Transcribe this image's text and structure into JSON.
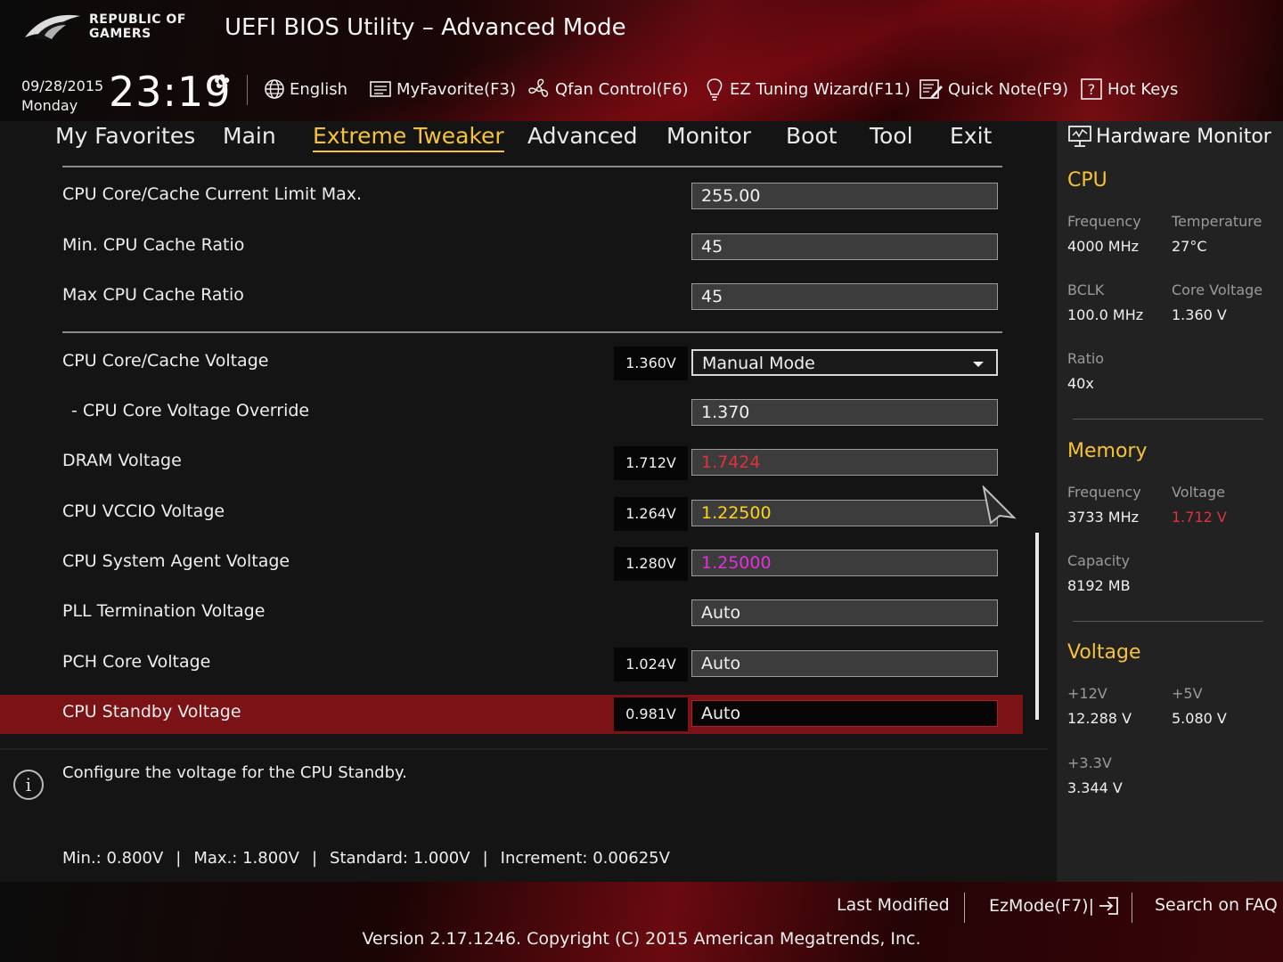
{
  "header": {
    "brand_line1": "REPUBLIC OF",
    "brand_line2": "GAMERS",
    "title": "UEFI BIOS Utility – Advanced Mode",
    "date": "09/28/2015",
    "day": "Monday",
    "time": "23:19",
    "tools": [
      {
        "label": "English",
        "icon": "globe-icon"
      },
      {
        "label": "MyFavorite(F3)",
        "icon": "favorite-icon"
      },
      {
        "label": "Qfan Control(F6)",
        "icon": "fan-icon"
      },
      {
        "label": "EZ Tuning Wizard(F11)",
        "icon": "bulb-icon"
      },
      {
        "label": "Quick Note(F9)",
        "icon": "note-icon"
      },
      {
        "label": "Hot Keys",
        "icon": "help-icon"
      }
    ]
  },
  "tabs": [
    {
      "label": "My Favorites"
    },
    {
      "label": "Main"
    },
    {
      "label": "Extreme Tweaker",
      "active": true
    },
    {
      "label": "Advanced"
    },
    {
      "label": "Monitor"
    },
    {
      "label": "Boot"
    },
    {
      "label": "Tool"
    },
    {
      "label": "Exit"
    }
  ],
  "settings": [
    {
      "label": "CPU Core/Cache Current Limit Max.",
      "value": "255.00"
    },
    {
      "label": "Min. CPU Cache Ratio",
      "value": "45"
    },
    {
      "label": "Max CPU Cache Ratio",
      "value": "45"
    },
    {
      "label": "CPU Core/Cache Voltage",
      "current": "1.360V",
      "value": "Manual Mode"
    },
    {
      "label": "- CPU Core Voltage Override",
      "value": "1.370"
    },
    {
      "label": "DRAM Voltage",
      "current": "1.712V",
      "value": "1.7424",
      "value_color": "#e0323a"
    },
    {
      "label": "CPU VCCIO Voltage",
      "current": "1.264V",
      "value": "1.22500",
      "value_color": "#ffd21a"
    },
    {
      "label": "CPU System Agent Voltage",
      "current": "1.280V",
      "value": "1.25000",
      "value_color": "#e52ee0"
    },
    {
      "label": "PLL Termination Voltage",
      "value": "Auto"
    },
    {
      "label": "PCH Core Voltage",
      "current": "1.024V",
      "value": "Auto"
    },
    {
      "label": "CPU Standby Voltage",
      "current": "0.981V",
      "value": "Auto",
      "selected": true
    }
  ],
  "help": {
    "description": "Configure the voltage for the CPU Standby.",
    "min": "Min.: 0.800V",
    "max": "Max.: 1.800V",
    "standard": "Standard: 1.000V",
    "increment": "Increment: 0.00625V",
    "separator": "|"
  },
  "hw_monitor": {
    "title": "Hardware Monitor",
    "cpu": {
      "title": "CPU",
      "frequency_label": "Frequency",
      "frequency": "4000 MHz",
      "temperature_label": "Temperature",
      "temperature": "27°C",
      "bclk_label": "BCLK",
      "bclk": "100.0 MHz",
      "core_voltage_label": "Core Voltage",
      "core_voltage": "1.360 V",
      "ratio_label": "Ratio",
      "ratio": "40x"
    },
    "memory": {
      "title": "Memory",
      "frequency_label": "Frequency",
      "frequency": "3733 MHz",
      "voltage_label": "Voltage",
      "voltage": "1.712 V",
      "capacity_label": "Capacity",
      "capacity": "8192 MB"
    },
    "voltage": {
      "title": "Voltage",
      "v12_label": "+12V",
      "v12": "12.288 V",
      "v5_label": "+5V",
      "v5": "5.080 V",
      "v33_label": "+3.3V",
      "v33": "3.344 V"
    }
  },
  "footer": {
    "last_modified": "Last Modified",
    "ezmode": "EzMode(F7)|",
    "search": "Search on FAQ",
    "version": "Version 2.17.1246. Copyright (C) 2015 American Megatrends, Inc."
  },
  "colors": {
    "accent": "#f6c338",
    "selected_row": "#7a1216",
    "dram_value": "#e0323a",
    "vccio_value": "#ffd21a",
    "sa_value": "#e52ee0"
  }
}
